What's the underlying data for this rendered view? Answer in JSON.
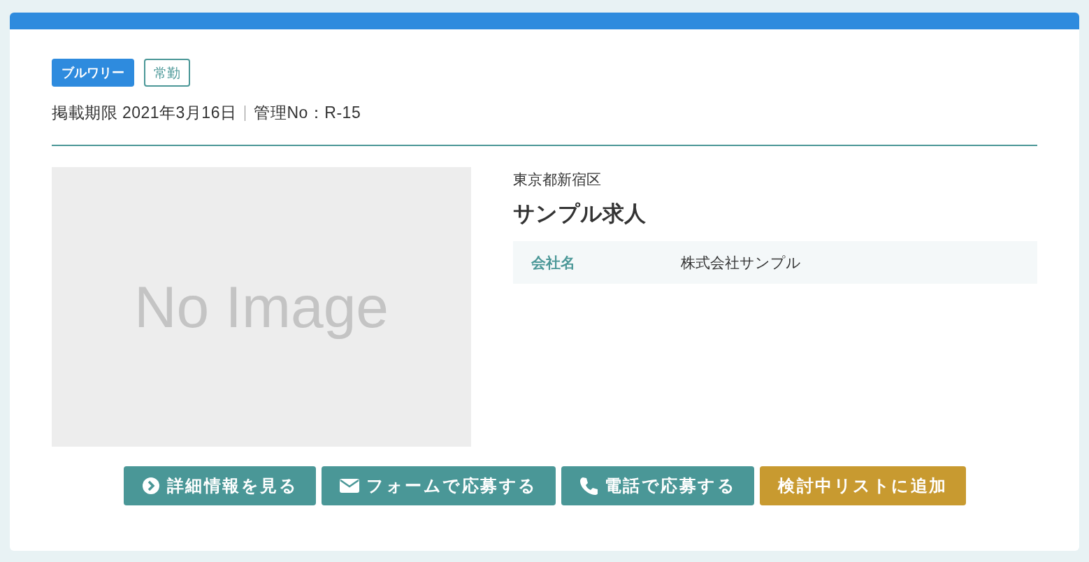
{
  "tags": [
    {
      "label": "ブルワリー",
      "kind": "filled"
    },
    {
      "label": "常勤",
      "kind": "outline"
    }
  ],
  "meta": [
    "掲載期限 2021年3月16日",
    "管理No：R-15"
  ],
  "image": {
    "text": "No Image"
  },
  "location": "東京都新宿区",
  "title": "サンプル求人",
  "details": [
    {
      "label": "会社名",
      "value": "株式会社サンプル"
    }
  ],
  "buttons": [
    {
      "label": "詳細情報を見る",
      "kind": "detail"
    },
    {
      "label": "フォームで応募する",
      "kind": "form"
    },
    {
      "label": "電話で応募する",
      "kind": "phone"
    },
    {
      "label": "検討中リストに追加",
      "kind": "list"
    }
  ]
}
